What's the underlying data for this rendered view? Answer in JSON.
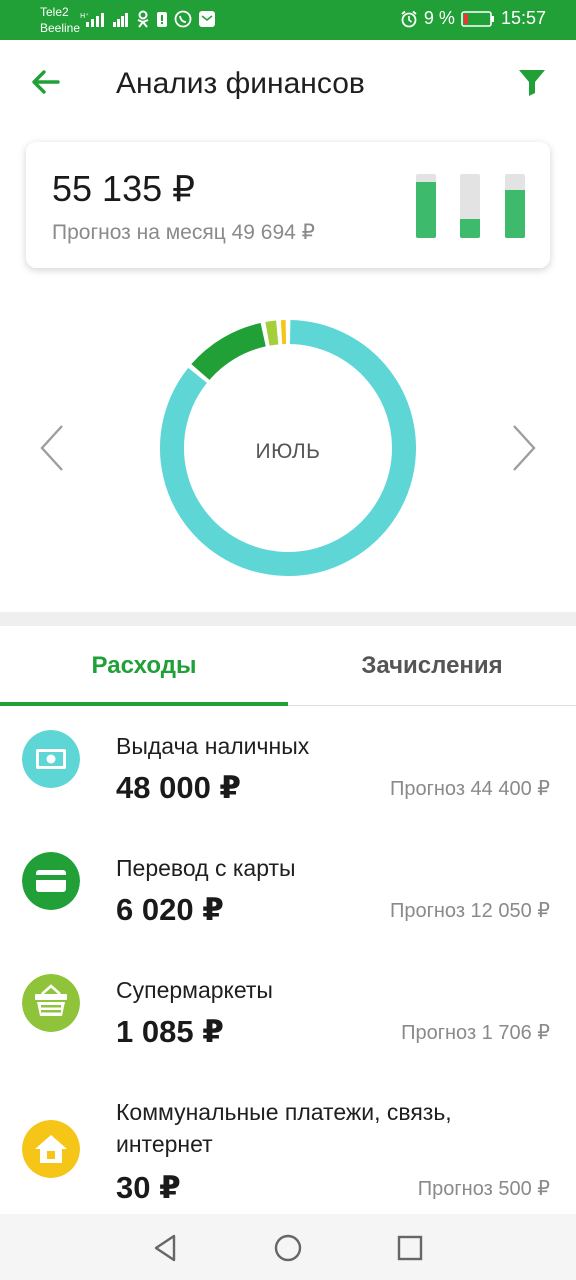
{
  "status": {
    "carrier1": "Tele2",
    "carrier2": "Beeline",
    "battery": "9 %",
    "time": "15:57"
  },
  "header": {
    "title": "Анализ финансов"
  },
  "summary": {
    "total": "55 135 ₽",
    "forecast": "Прогноз на месяц 49 694 ₽",
    "mini_bars": [
      0.88,
      0.3,
      0.75
    ]
  },
  "chart": {
    "month": "ИЮЛЬ",
    "colors": {
      "cash": "#5ed6d6",
      "transfer": "#21a038",
      "supermarket": "#a5cf3a",
      "utilities": "#f5c518"
    }
  },
  "tabs": [
    {
      "label": "Расходы",
      "active": true
    },
    {
      "label": "Зачисления",
      "active": false
    }
  ],
  "expenses": [
    {
      "name": "Выдача наличных",
      "amount": "48 000 ₽",
      "forecast": "Прогноз 44 400 ₽",
      "icon": "cash-icon",
      "color": "#5ed6d6"
    },
    {
      "name": "Перевод с карты",
      "amount": "6 020 ₽",
      "forecast": "Прогноз 12 050 ₽",
      "icon": "card-icon",
      "color": "#21a038"
    },
    {
      "name": "Супермаркеты",
      "amount": "1 085 ₽",
      "forecast": "Прогноз 1 706 ₽",
      "icon": "basket-icon",
      "color": "#8fc43a"
    },
    {
      "name": "Коммунальные платежи, связь, интернет",
      "amount": "30 ₽",
      "forecast": "Прогноз 500 ₽",
      "icon": "house-icon",
      "color": "#f5c518"
    }
  ],
  "chart_data": {
    "type": "pie",
    "categories": [
      "Выдача наличных",
      "Перевод с карты",
      "Супермаркеты",
      "Коммунальные платежи, связь, интернет"
    ],
    "values": [
      48000,
      6020,
      1085,
      30
    ],
    "title": "ИЮЛЬ"
  }
}
